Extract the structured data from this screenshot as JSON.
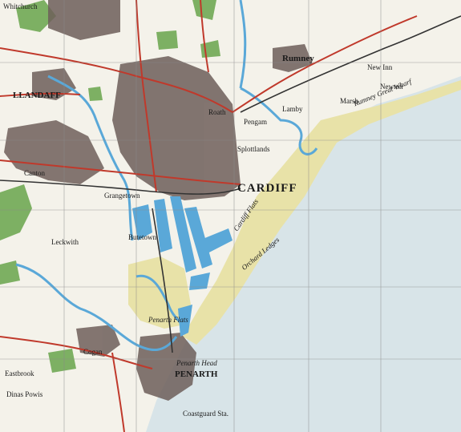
{
  "map": {
    "colors": {
      "sea": "#d8e4e8",
      "land": "#f4f2ea",
      "urban": "#6e5f5a",
      "mudflat": "#e8e2a8",
      "water": "#5aa8d8",
      "woodland": "#7db063",
      "roads": "#c0392b",
      "railways": "#333333",
      "grid": "#8a8a8a"
    },
    "labels": {
      "cardiff": "CARDIFF",
      "penarth": "PENARTH",
      "penarth_head": "Penarth Head",
      "penarth_flats": "Penarth Flats",
      "cardiff_flats": "Cardiff Flats",
      "orchard_ledges": "Orchard Ledges",
      "splott": "Splottlands",
      "rumney": "Rumney",
      "lamby": "Lamby",
      "pengam": "Pengam",
      "llandaff": "LLANDAFF",
      "canton": "Canton",
      "grangetown": "Grangetown",
      "butetown": "Butetown",
      "cogan": "Cogan",
      "eastbrook": "Eastbrook",
      "dinas_powis": "Dinas Powis",
      "leckwith": "Leckwith",
      "whitchurch": "Whitchurch",
      "roath": "Roath",
      "rumney_great_wharf": "Rumney Great Wharf",
      "new_inn": "New Inn",
      "marsh": "Marsh",
      "newton": "Newton",
      "coastguard": "Coastguard Sta."
    }
  }
}
